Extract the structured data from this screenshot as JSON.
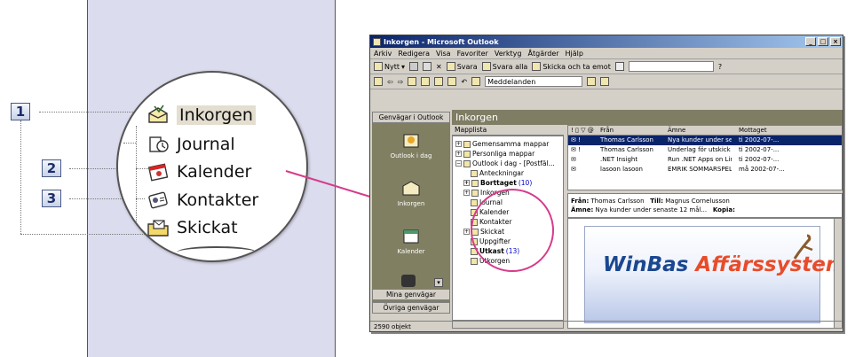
{
  "callouts": [
    "1",
    "2",
    "3"
  ],
  "magnifier": {
    "items": [
      {
        "label": "Inkorgen",
        "icon": "inbox-icon"
      },
      {
        "label": "Journal",
        "icon": "journal-icon"
      },
      {
        "label": "Kalender",
        "icon": "calendar-icon"
      },
      {
        "label": "Kontakter",
        "icon": "contacts-icon"
      },
      {
        "label": "Skickat",
        "icon": "sent-icon"
      }
    ]
  },
  "window": {
    "title": "Inkorgen - Microsoft Outlook",
    "menu": [
      "Arkiv",
      "Redigera",
      "Visa",
      "Favoriter",
      "Verktyg",
      "Åtgärder",
      "Hjälp"
    ],
    "toolbar1": [
      "Nytt",
      "Svara",
      "Svara alla",
      "Skicka och ta emot"
    ],
    "toolbar2_input": "Meddelanden",
    "nav": {
      "header": "Genvägar i Outlook",
      "items": [
        "Outlook i dag",
        "Inkorgen",
        "Kalender"
      ],
      "bottom_buttons": [
        "Mina genvägar",
        "Övriga genvägar"
      ]
    },
    "pane_title": "Inkorgen",
    "folder_header": "Mapplista",
    "folders": [
      {
        "label": "Gemensamma mappar",
        "bold": false,
        "count": ""
      },
      {
        "label": "Personliga mappar",
        "bold": false,
        "count": ""
      },
      {
        "label": "Outlook i dag - [Postfäl...",
        "bold": false,
        "count": ""
      },
      {
        "label": "Anteckningar",
        "bold": false,
        "count": ""
      },
      {
        "label": "Borttaget",
        "bold": true,
        "count": "(10)"
      },
      {
        "label": "Inkorgen",
        "bold": false,
        "count": ""
      },
      {
        "label": "Journal",
        "bold": false,
        "count": ""
      },
      {
        "label": "Kalender",
        "bold": false,
        "count": ""
      },
      {
        "label": "Kontakter",
        "bold": false,
        "count": ""
      },
      {
        "label": "Skickat",
        "bold": false,
        "count": ""
      },
      {
        "label": "Uppgifter",
        "bold": false,
        "count": ""
      },
      {
        "label": "Utkast",
        "bold": true,
        "count": "(13)"
      },
      {
        "label": "Utkorgen",
        "bold": false,
        "count": ""
      }
    ],
    "msg_columns": [
      "Från",
      "Ämne",
      "Mottaget"
    ],
    "messages": [
      {
        "from": "Thomas Carlsson",
        "subject": "Nya kunder under sen...",
        "date": "ti 2002-07-..."
      },
      {
        "from": "Thomas Carlsson",
        "subject": "Underlag för utskick",
        "date": "ti 2002-07-..."
      },
      {
        "from": ".NET Insight",
        "subject": "Run .NET Apps on Lin...",
        "date": "ti 2002-07-..."
      },
      {
        "from": "lasoon lasoon",
        "subject": "EMRIK SOMMARSPEL...",
        "date": "må 2002-07-..."
      }
    ],
    "preview": {
      "from_label": "Från:",
      "from": "Thomas Carlsson",
      "to_label": "Till:",
      "to": "Magnus Cornelusson",
      "subject_label": "Ämne:",
      "subject": "Nya kunder under senaste 12 mål...",
      "cc_label": "Kopia:"
    },
    "banner": {
      "word1": "WinBas ",
      "word2": "Affärssystem"
    },
    "status": "2590 objekt"
  },
  "colors": {
    "panel": "#dcdcef",
    "connector": "#d63b8a",
    "titlebar": "#0a246a",
    "navpane": "#807f62"
  }
}
